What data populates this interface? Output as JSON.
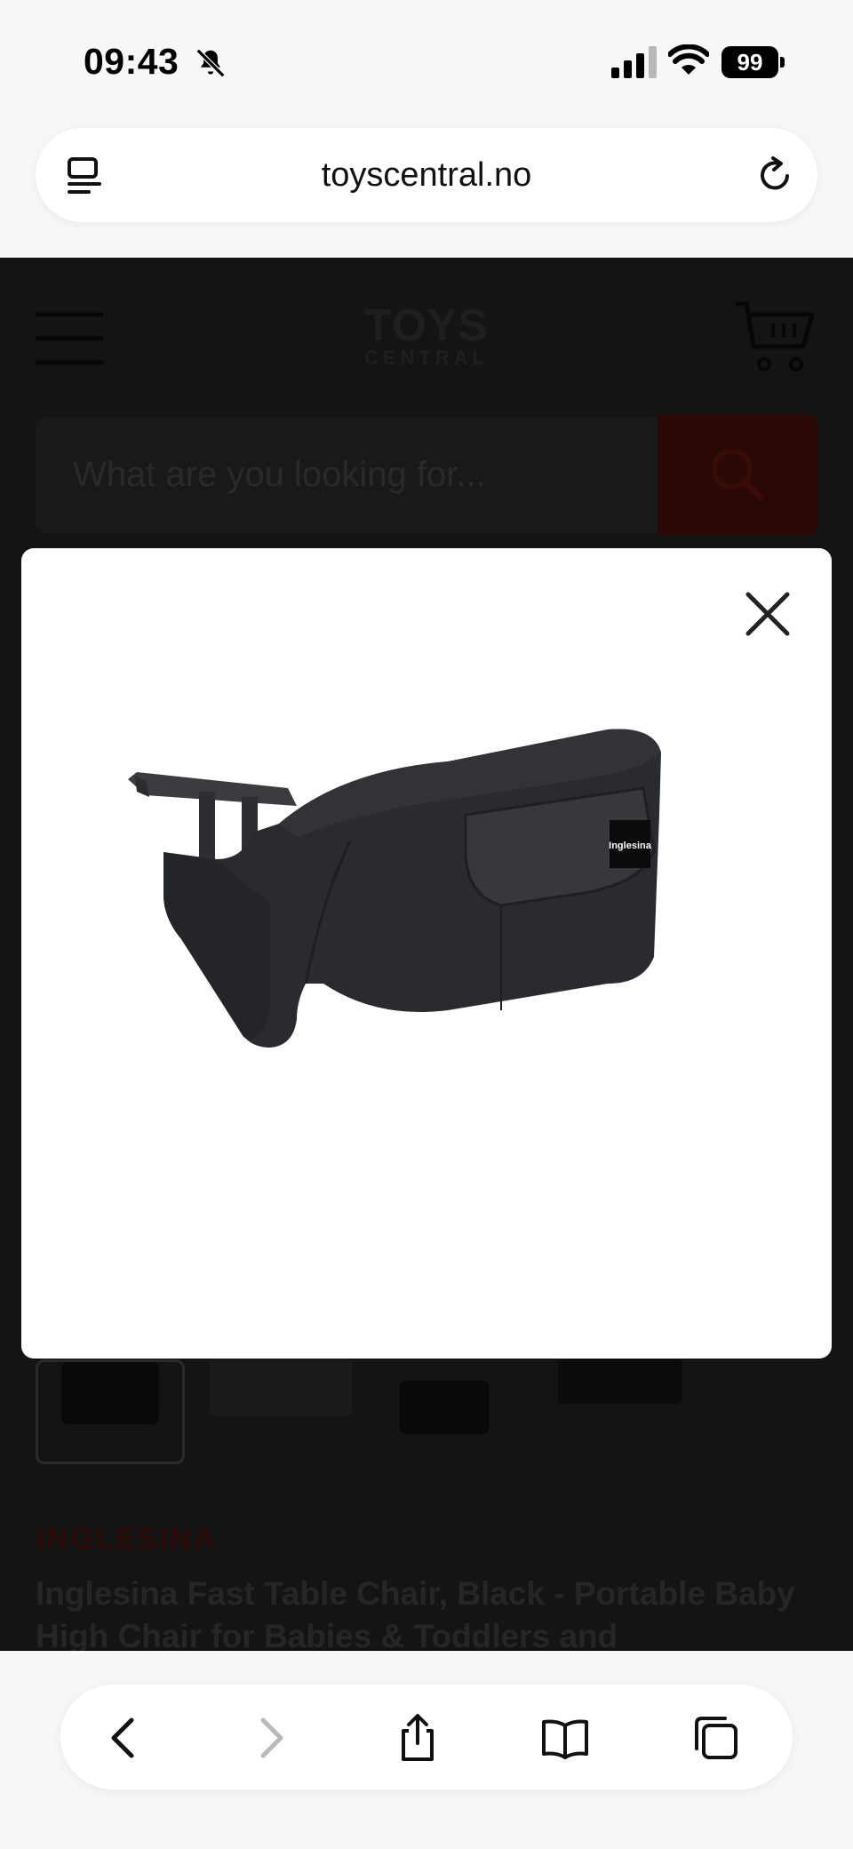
{
  "status_bar": {
    "time": "09:43",
    "battery": "99"
  },
  "browser": {
    "url": "toyscentral.no"
  },
  "site": {
    "logo_top": "TOYS",
    "logo_bottom": "CENTRAL",
    "search_placeholder": "What are you looking for...",
    "brand": "INGLESINA",
    "product_title": "Inglesina Fast Table Chair, Black - Portable Baby High Chair for Babies & Toddlers and"
  },
  "modal": {
    "product_label": "Inglesina"
  },
  "colors": {
    "accent": "#c0160b",
    "page_dim": "#141414"
  }
}
